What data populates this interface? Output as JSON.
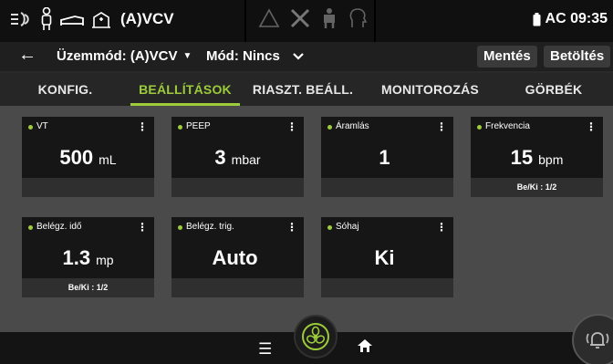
{
  "status": {
    "mode": "(A)VCV",
    "clock": "AC 09:35"
  },
  "modebar": {
    "mode_label": "Üzemmód: (A)VCV",
    "mod_label": "Mód: Nincs",
    "save_label": "Mentés",
    "load_label": "Betöltés"
  },
  "tabs": [
    {
      "label": "KONFIG.",
      "active": false
    },
    {
      "label": "BEÁLLÍTÁSOK",
      "active": true
    },
    {
      "label": "RIASZT. BEÁLL.",
      "active": false
    },
    {
      "label": "MONITOROZÁS",
      "active": false
    },
    {
      "label": "GÖRBÉK",
      "active": false
    }
  ],
  "cards": [
    {
      "name": "VT",
      "value": "500",
      "unit": "mL",
      "footer": ""
    },
    {
      "name": "PEEP",
      "value": "3",
      "unit": "mbar",
      "footer": ""
    },
    {
      "name": "Áramlás",
      "value": "1",
      "unit": "",
      "footer": ""
    },
    {
      "name": "Frekvencia",
      "value": "15",
      "unit": "bpm",
      "footer": "Be/Ki : 1/2"
    },
    {
      "name": "Belégz. idő",
      "value": "1.3",
      "unit": "mp",
      "footer": "Be/Ki : 1/2"
    },
    {
      "name": "Belégz. trig.",
      "value": "Auto",
      "unit": "",
      "footer": ""
    },
    {
      "name": "Sóhaj",
      "value": "Ki",
      "unit": "",
      "footer": ""
    }
  ],
  "colors": {
    "accent": "#9ccc3a",
    "card_bg": "#161616",
    "content_bg": "#4a4a4a"
  },
  "icons": [
    "ventilator-icon",
    "patient-icon",
    "bed-icon",
    "hospital-icon",
    "warning-icon",
    "tools-icon",
    "person-icon",
    "head-icon",
    "battery-icon",
    "back-arrow-icon",
    "menu-icon",
    "fan-icon",
    "home-icon",
    "alarm-bell-icon"
  ]
}
